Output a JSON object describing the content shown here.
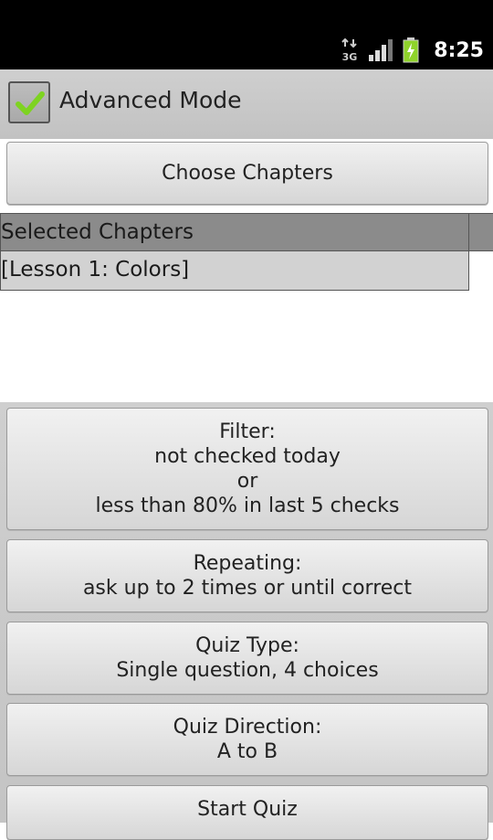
{
  "status_bar": {
    "network_label": "3G",
    "time": "8:25",
    "icons": [
      "data-3g-icon",
      "signal-icon",
      "battery-charging-icon"
    ]
  },
  "advanced_mode": {
    "label": "Advanced Mode",
    "checked": true
  },
  "choose_chapters": {
    "label": "Choose Chapters"
  },
  "selected_chapters": {
    "header": "Selected Chapters",
    "items": [
      "[Lesson 1: Colors]"
    ]
  },
  "filter": {
    "title": "Filter:",
    "line1": "not checked today",
    "line2": "or",
    "line3": "less than 80% in last 5 checks"
  },
  "repeating": {
    "title": "Repeating:",
    "value": "ask up to 2 times or until correct"
  },
  "quiz_type": {
    "title": "Quiz Type:",
    "value": "Single question, 4 choices"
  },
  "quiz_direction": {
    "title": "Quiz Direction:",
    "value": "A to B"
  },
  "start_quiz": {
    "label": "Start Quiz"
  },
  "colors": {
    "check_green": "#7ed321",
    "status_bg": "#000000"
  }
}
